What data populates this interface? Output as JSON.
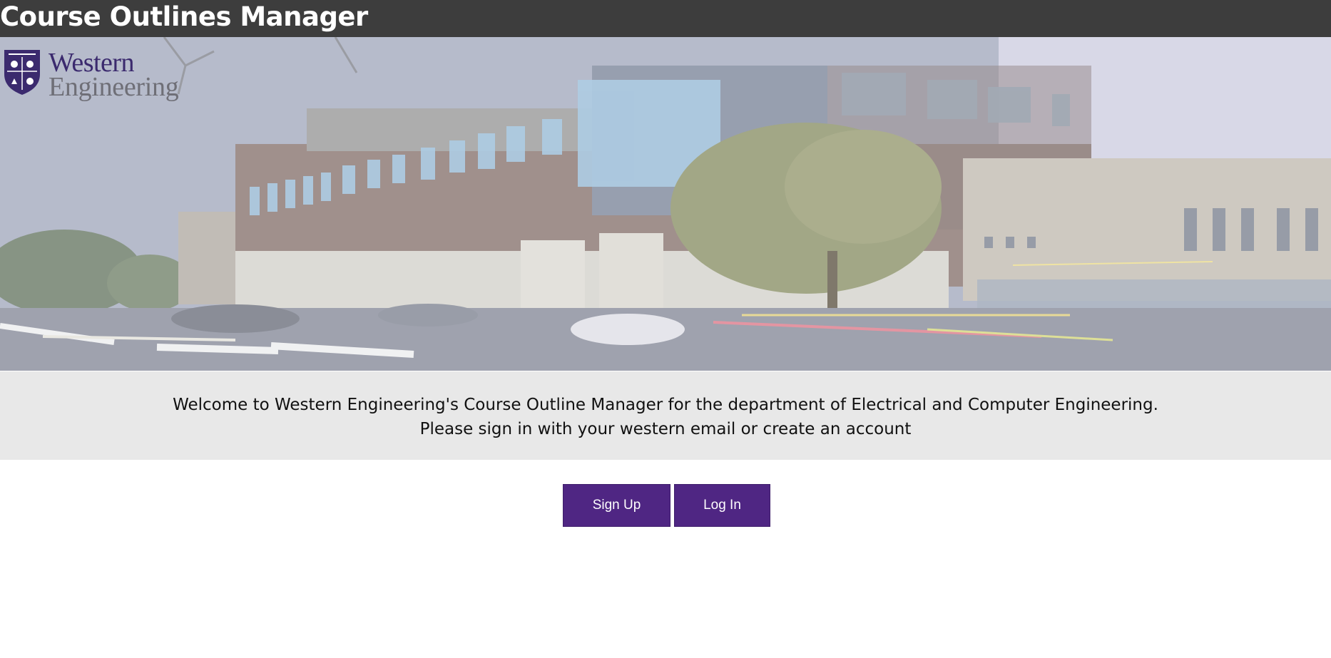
{
  "header": {
    "title": "Course Outlines Manager"
  },
  "hero": {
    "logo": {
      "line1": "Western",
      "line2": "Engineering"
    },
    "image": "building-photo"
  },
  "welcome": {
    "line1": "Welcome to Western Engineering's Course Outline Manager for the department of Electrical and Computer Engineering.",
    "line2": "Please sign in with your western email or create an account"
  },
  "actions": {
    "signup_label": "Sign Up",
    "login_label": "Log In"
  },
  "colors": {
    "header_bg": "#3d3d3d",
    "accent": "#4f2683",
    "welcome_bg": "#e8e8e8"
  }
}
